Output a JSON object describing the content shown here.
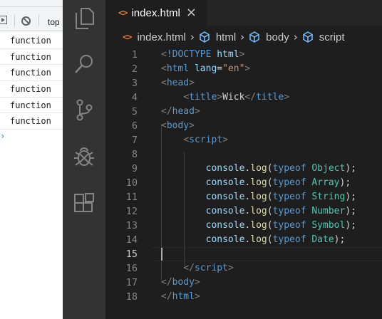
{
  "devtools": {
    "toolbar_context": "top",
    "console_lines": [
      "function",
      "function",
      "function",
      "function",
      "function",
      "function"
    ],
    "prompt": "›"
  },
  "activity_bar": {
    "icons": [
      "explorer-icon",
      "search-icon",
      "source-control-icon",
      "debug-icon",
      "extensions-icon"
    ]
  },
  "editor": {
    "tab": {
      "icon": "<>",
      "label": "index.html",
      "close": "×"
    },
    "breadcrumb": [
      {
        "icon": "html-file-icon",
        "label": "index.html"
      },
      {
        "icon": "symbol-icon",
        "label": "html"
      },
      {
        "icon": "symbol-icon",
        "label": "body"
      },
      {
        "icon": "symbol-icon",
        "label": "script"
      }
    ],
    "current_line": 15,
    "lines": [
      {
        "n": "1",
        "tokens": [
          [
            "br",
            "<"
          ],
          [
            "tag",
            "!DOCTYPE"
          ],
          [
            "text",
            " "
          ],
          [
            "attr",
            "html"
          ],
          [
            "br",
            ">"
          ]
        ]
      },
      {
        "n": "2",
        "tokens": [
          [
            "br",
            "<"
          ],
          [
            "tag",
            "html"
          ],
          [
            "text",
            " "
          ],
          [
            "attr",
            "lang"
          ],
          [
            "text",
            "="
          ],
          [
            "str",
            "\"en\""
          ],
          [
            "br",
            ">"
          ]
        ]
      },
      {
        "n": "3",
        "tokens": [
          [
            "br",
            "<"
          ],
          [
            "tag",
            "head"
          ],
          [
            "br",
            ">"
          ]
        ]
      },
      {
        "n": "4",
        "tokens": [
          [
            "text",
            "    "
          ],
          [
            "br",
            "<"
          ],
          [
            "tag",
            "title"
          ],
          [
            "br",
            ">"
          ],
          [
            "text",
            "Wick"
          ],
          [
            "br",
            "</"
          ],
          [
            "tag",
            "title"
          ],
          [
            "br",
            ">"
          ]
        ]
      },
      {
        "n": "5",
        "tokens": [
          [
            "br",
            "</"
          ],
          [
            "tag",
            "head"
          ],
          [
            "br",
            ">"
          ]
        ]
      },
      {
        "n": "6",
        "tokens": [
          [
            "br",
            "<"
          ],
          [
            "tag",
            "body"
          ],
          [
            "br",
            ">"
          ]
        ]
      },
      {
        "n": "7",
        "tokens": [
          [
            "text",
            "    "
          ],
          [
            "br",
            "<"
          ],
          [
            "tag",
            "script"
          ],
          [
            "br",
            ">"
          ]
        ]
      },
      {
        "n": "8",
        "tokens": []
      },
      {
        "n": "9",
        "tokens": [
          [
            "text",
            "        "
          ],
          [
            "obj",
            "console"
          ],
          [
            "text",
            "."
          ],
          [
            "fn",
            "log"
          ],
          [
            "text",
            "("
          ],
          [
            "kw",
            "typeof"
          ],
          [
            "text",
            " "
          ],
          [
            "cls",
            "Object"
          ],
          [
            "text",
            ");"
          ]
        ]
      },
      {
        "n": "10",
        "tokens": [
          [
            "text",
            "        "
          ],
          [
            "obj",
            "console"
          ],
          [
            "text",
            "."
          ],
          [
            "fn",
            "log"
          ],
          [
            "text",
            "("
          ],
          [
            "kw",
            "typeof"
          ],
          [
            "text",
            " "
          ],
          [
            "cls",
            "Array"
          ],
          [
            "text",
            ");"
          ]
        ]
      },
      {
        "n": "11",
        "tokens": [
          [
            "text",
            "        "
          ],
          [
            "obj",
            "console"
          ],
          [
            "text",
            "."
          ],
          [
            "fn",
            "log"
          ],
          [
            "text",
            "("
          ],
          [
            "kw",
            "typeof"
          ],
          [
            "text",
            " "
          ],
          [
            "cls",
            "String"
          ],
          [
            "text",
            ");"
          ]
        ]
      },
      {
        "n": "12",
        "tokens": [
          [
            "text",
            "        "
          ],
          [
            "obj",
            "console"
          ],
          [
            "text",
            "."
          ],
          [
            "fn",
            "log"
          ],
          [
            "text",
            "("
          ],
          [
            "kw",
            "typeof"
          ],
          [
            "text",
            " "
          ],
          [
            "cls",
            "Number"
          ],
          [
            "text",
            ");"
          ]
        ]
      },
      {
        "n": "13",
        "tokens": [
          [
            "text",
            "        "
          ],
          [
            "obj",
            "console"
          ],
          [
            "text",
            "."
          ],
          [
            "fn",
            "log"
          ],
          [
            "text",
            "("
          ],
          [
            "kw",
            "typeof"
          ],
          [
            "text",
            " "
          ],
          [
            "cls",
            "Symbol"
          ],
          [
            "text",
            ");"
          ]
        ]
      },
      {
        "n": "14",
        "tokens": [
          [
            "text",
            "        "
          ],
          [
            "obj",
            "console"
          ],
          [
            "text",
            "."
          ],
          [
            "fn",
            "log"
          ],
          [
            "text",
            "("
          ],
          [
            "kw",
            "typeof"
          ],
          [
            "text",
            " "
          ],
          [
            "cls",
            "Date"
          ],
          [
            "text",
            ");"
          ]
        ]
      },
      {
        "n": "15",
        "tokens": []
      },
      {
        "n": "16",
        "tokens": [
          [
            "text",
            "    "
          ],
          [
            "br",
            "</"
          ],
          [
            "tag",
            "script"
          ],
          [
            "br",
            ">"
          ]
        ]
      },
      {
        "n": "17",
        "tokens": [
          [
            "br",
            "</"
          ],
          [
            "tag",
            "body"
          ],
          [
            "br",
            ">"
          ]
        ]
      },
      {
        "n": "18",
        "tokens": [
          [
            "br",
            "</"
          ],
          [
            "tag",
            "html"
          ],
          [
            "br",
            ">"
          ]
        ]
      }
    ]
  },
  "colors": {
    "tag": "#569cd6",
    "bracket": "#808080",
    "attribute": "#9cdcfe",
    "string": "#ce9178",
    "function": "#dcdcaa",
    "class": "#4ec9b0",
    "background": "#1e1e1e",
    "activity_bar": "#333333"
  }
}
